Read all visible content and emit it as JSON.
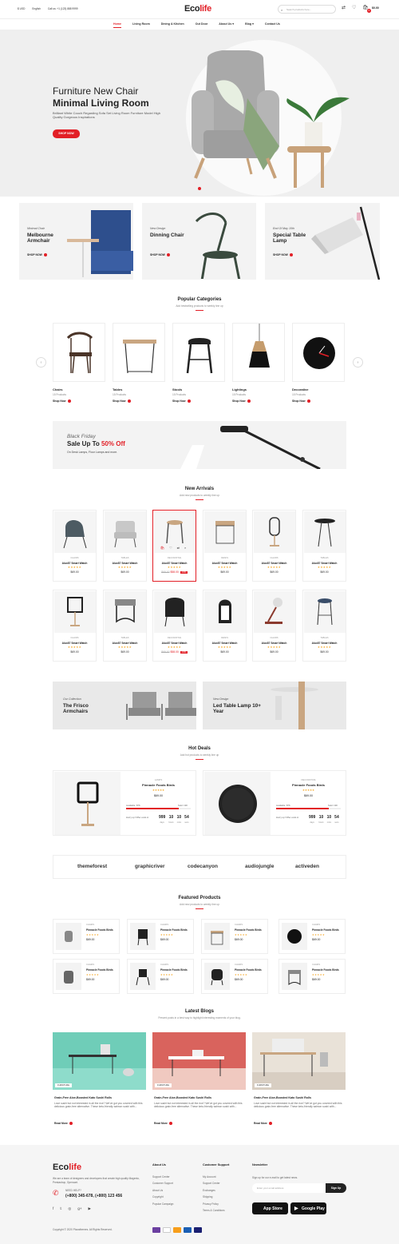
{
  "topbar": {
    "currency": "$ USD",
    "language": "English",
    "phone": "Call us: +1 (123) 888 9999",
    "logo_main": "Eco",
    "logo_accent": "life",
    "search_placeholder": "Search products here...",
    "cart_total": "$0.00",
    "cart_count": "0"
  },
  "nav": {
    "items": [
      "Home",
      "Living Room",
      "Dining & Kitchen",
      "Out Door",
      "About Us",
      "Blog",
      "Contact Us"
    ]
  },
  "hero": {
    "title1": "Furniture New Chair",
    "title2": "Minimal Living Room",
    "desc": "Brilliant White Couch Regarding Sofa Set Living Room Furniture Model High Quality Gorgeous Inspirations",
    "button": "SHOP NOW"
  },
  "banners": [
    {
      "small": "Minimal Chair",
      "big": "Melbourne Armchair",
      "shop": "SHOP NOW"
    },
    {
      "small": "New Design",
      "big": "Dinning Chair",
      "shop": "SHOP NOW"
    },
    {
      "small": "End Of May 10th",
      "big": "Special Table Lamp",
      "shop": "SHOP NOW"
    }
  ],
  "categories": {
    "title": "Popular Categories",
    "subtitle": "Add bestselling products to weekly line up",
    "items": [
      {
        "name": "Chairs",
        "count": "15 Products",
        "shop": "Shop Now"
      },
      {
        "name": "Tables",
        "count": "15 Products",
        "shop": "Shop Now"
      },
      {
        "name": "Stools",
        "count": "15 Products",
        "shop": "Shop Now"
      },
      {
        "name": "Lightings",
        "count": "15 Products",
        "shop": "Shop Now"
      },
      {
        "name": "Decorative",
        "count": "15 Products",
        "shop": "Shop Now"
      }
    ]
  },
  "promo": {
    "kicker": "Black Friday",
    "headline": "Sale Up To",
    "percent": "50% Off",
    "desc": "On Desk Lamps, Floor Lamps and more."
  },
  "arrivals": {
    "title": "New Arrivals",
    "subtitle": "Add new products to weekly line up",
    "row1": [
      {
        "cat": "CHAIRS",
        "name": "Alux87 Smart Watch",
        "stars": "★★★★★",
        "price": "$69.00"
      },
      {
        "cat": "TABLES",
        "name": "Alux87 Smart Watch",
        "stars": "★★★★★",
        "price": "$69.00"
      },
      {
        "cat": "DECORATIVE",
        "name": "Alux87 Smart Watch",
        "stars": "★★★★★",
        "old": "$69.00",
        "new": "$58.00",
        "sale": "-15%"
      },
      {
        "cat": "DESKS",
        "name": "Alux87 Smart Watch",
        "stars": "★★★★★",
        "price": "$69.00"
      },
      {
        "cat": "CHAIRS",
        "name": "Alux87 Smart Watch",
        "stars": "★★★★★",
        "price": "$69.00"
      },
      {
        "cat": "TABLES",
        "name": "Alux87 Smart Watch",
        "stars": "★★★★★",
        "price": "$69.00"
      }
    ],
    "row2": [
      {
        "cat": "CHAIRS",
        "name": "Alux87 Smart Watch",
        "stars": "★★★★★",
        "price": "$69.00"
      },
      {
        "cat": "TABLES",
        "name": "Alux87 Smart Watch",
        "stars": "★★★★★",
        "price": "$69.00"
      },
      {
        "cat": "DECORATIVE",
        "name": "Alux87 Smart Watch",
        "stars": "★★★★★",
        "old": "$69.00",
        "new": "$58.00",
        "sale": "-15%"
      },
      {
        "cat": "DESKS",
        "name": "Alux87 Smart Watch",
        "stars": "★★★★★",
        "price": "$69.00"
      },
      {
        "cat": "CHAIRS",
        "name": "Alux87 Smart Watch",
        "stars": "★★★★★",
        "price": "$69.00"
      },
      {
        "cat": "TABLES",
        "name": "Alux87 Smart Watch",
        "stars": "★★★★★",
        "price": "$69.00"
      }
    ]
  },
  "bottom_banners": [
    {
      "small": "Our Collection",
      "big": "The Frisco Armchairs"
    },
    {
      "small": "New Design",
      "big": "Led Table Lamp 10+ Year"
    }
  ],
  "deals": {
    "title": "Hot Deals",
    "subtitle": "Add hot products to weekly line up",
    "items": [
      {
        "cat": "LAMPS",
        "name": "Pinnacle Foods Birds",
        "stars": "★★★★★",
        "price": "$69.00",
        "available": "Available: 876",
        "sold": "Sold: 190",
        "hurry": "Hurry up! Offer ends in:",
        "d": "999",
        "h": "10",
        "m": "10",
        "s": "54"
      },
      {
        "cat": "DECORATIVE",
        "name": "Pinnacle Foods Birds",
        "stars": "★★★★★",
        "price": "$69.00",
        "available": "Available: 876",
        "sold": "Sold: 190",
        "hurry": "Hurry up! Offer ends in:",
        "d": "999",
        "h": "10",
        "m": "10",
        "s": "54"
      }
    ],
    "units": [
      "days",
      "hours",
      "mins",
      "secs"
    ]
  },
  "brands": [
    "themeforest",
    "graphicriver",
    "codecanyon",
    "audiojungle",
    "activeden"
  ],
  "featured": {
    "title": "Featured Products",
    "subtitle": "Add new products to weekly line up",
    "items": [
      {
        "cat": "CHAIRS",
        "name": "Pinnacle Foods Birds",
        "stars": "★★★★★",
        "price": "$69.00"
      },
      {
        "cat": "CHAIRS",
        "name": "Pinnacle Foods Birds",
        "stars": "★★★★★",
        "price": "$69.00"
      },
      {
        "cat": "CHAIRS",
        "name": "Pinnacle Foods Birds",
        "stars": "★★★★★",
        "price": "$69.00"
      },
      {
        "cat": "CHAIRS",
        "name": "Pinnacle Foods Birds",
        "stars": "★★★★★",
        "price": "$69.00"
      },
      {
        "cat": "CHAIRS",
        "name": "Pinnacle Foods Birds",
        "stars": "★★★★★",
        "price": "$69.00"
      },
      {
        "cat": "CHAIRS",
        "name": "Pinnacle Foods Birds",
        "stars": "★★★★★",
        "price": "$69.00"
      },
      {
        "cat": "CHAIRS",
        "name": "Pinnacle Foods Birds",
        "stars": "★★★★★",
        "price": "$69.00"
      },
      {
        "cat": "CHAIRS",
        "name": "Pinnacle Foods Birds",
        "stars": "★★★★★",
        "price": "$69.00"
      }
    ]
  },
  "blogs": {
    "title": "Latest Blogs",
    "subtitle": "Present posts in a best way to highlight interesting moments of your blog.",
    "items": [
      {
        "tag": "FURNITURE",
        "title": "Grain-Free Aloe-Boosted Kato Sushi Rolls",
        "desc": "Love sushi but not interested in all the rice? We've got you covered with this delicious grain-free alternative. These keto-friendly salmon sushi with...",
        "more": "Read More"
      },
      {
        "tag": "FURNITURE",
        "title": "Grain-Free Aloe-Boosted Kato Sushi Rolls",
        "desc": "Love sushi but not interested in all the rice? We've got you covered with this delicious grain-free alternative. These keto-friendly salmon sushi with...",
        "more": "Read More"
      },
      {
        "tag": "FURNITURE",
        "title": "Grain-Free Aloe-Boosted Kato Sushi Rolls",
        "desc": "Love sushi but not interested in all the rice? We've got you covered with this delicious grain-free alternative. These keto-friendly salmon sushi with...",
        "more": "Read More"
      }
    ]
  },
  "footer": {
    "about": "We are a team of designers and developers that create high quality Magento, Prestashop, Opencart.",
    "need_help": "NEED HELP?",
    "phones": "(+800) 345-678, (+800) 123 456",
    "copyright": "Copyright © 2020 Plazathemes. All Rights Reserved.",
    "about_title": "About Us",
    "about_links": [
      "Support Center",
      "Customer Support",
      "About Us",
      "Copyright",
      "Popular Campaign"
    ],
    "support_title": "Customer Support",
    "support_links": [
      "My Account",
      "Support Center",
      "Exchanges",
      "Shipping",
      "Privacy Policy",
      "Terms & Conditions"
    ],
    "newsletter_title": "Newsletter",
    "newsletter_desc": "Sign up for our e-mail to get latest news.",
    "email_placeholder": "Enter your email address",
    "signup": "Sign Up",
    "app_store": "App Store",
    "google_play": "Google Play"
  },
  "colors": {
    "accent": "#e21f26",
    "star": "#f5a623"
  }
}
